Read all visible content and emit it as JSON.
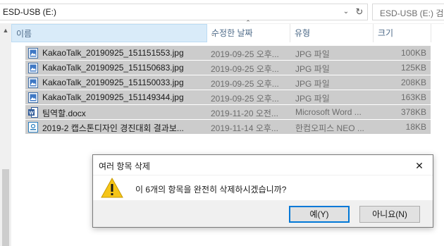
{
  "address": {
    "path": "ESD-USB (E:)",
    "dropdown_icon": "chevron-down-icon",
    "refresh_icon": "refresh-icon",
    "search_placeholder": "ESD-USB (E:) 검색"
  },
  "columns": {
    "name": "이름",
    "date": "수정한 날짜",
    "type": "유형",
    "size": "크기"
  },
  "files": [
    {
      "name": "KakaoTalk_20190925_151151553.jpg",
      "date": "2019-09-25 오후...",
      "type": "JPG 파일",
      "size": "100KB",
      "icon": "image-file-icon"
    },
    {
      "name": "KakaoTalk_20190925_151150683.jpg",
      "date": "2019-09-25 오후...",
      "type": "JPG 파일",
      "size": "125KB",
      "icon": "image-file-icon"
    },
    {
      "name": "KakaoTalk_20190925_151150033.jpg",
      "date": "2019-09-25 오후...",
      "type": "JPG 파일",
      "size": "208KB",
      "icon": "image-file-icon"
    },
    {
      "name": "KakaoTalk_20190925_151149344.jpg",
      "date": "2019-09-25 오후...",
      "type": "JPG 파일",
      "size": "163KB",
      "icon": "image-file-icon"
    },
    {
      "name": "팀역할.docx",
      "date": "2019-11-20 오전...",
      "type": "Microsoft Word ...",
      "size": "378KB",
      "icon": "word-file-icon"
    },
    {
      "name": "2019-2 캡스톤디자인 경진대회 결과보...",
      "date": "2019-11-14 오후...",
      "type": "한컴오피스 NEO ...",
      "size": "18KB",
      "icon": "hwp-file-icon"
    }
  ],
  "dialog": {
    "title": "여러 항목 삭제",
    "message": "이 6개의 항목을 완전히 삭제하시겠습니까?",
    "yes_label": "예(Y)",
    "no_label": "아니요(N)",
    "icon": "warning-icon",
    "close_icon": "close-icon"
  },
  "colors": {
    "selection": "#cccccc",
    "header_highlight": "#d9ebf9",
    "header_text": "#4d6a88",
    "accent": "#0078d7",
    "warning": "#f5c518"
  }
}
